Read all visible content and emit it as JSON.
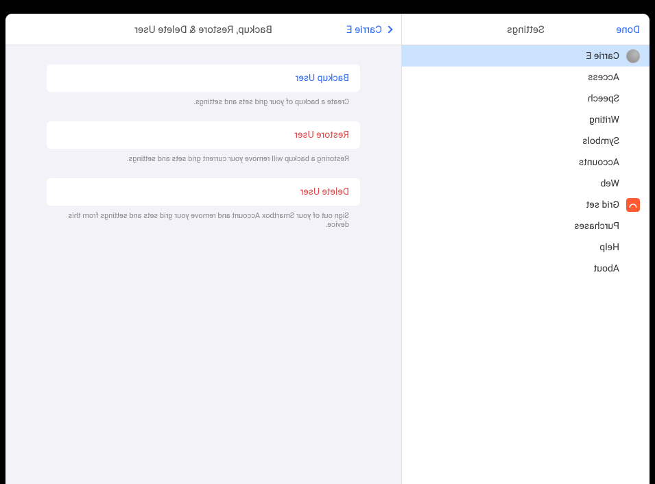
{
  "header": {
    "done": "Done",
    "settings_title": "Settings",
    "back_label": "Carrie E",
    "page_title": "Backup, Restore & Delete User"
  },
  "sidebar": {
    "user": {
      "name": "Carrie E"
    },
    "items": [
      {
        "label": "Access"
      },
      {
        "label": "Speech"
      },
      {
        "label": "Writing"
      },
      {
        "label": "Symbols"
      },
      {
        "label": "Accounts"
      },
      {
        "label": "Web"
      },
      {
        "label": "Grid set",
        "icon": "gridset"
      },
      {
        "label": "Purchases"
      },
      {
        "label": "Help"
      },
      {
        "label": "About"
      }
    ]
  },
  "actions": {
    "backup": {
      "title": "Backup User",
      "desc": "Create a backup of your grid sets and settings."
    },
    "restore": {
      "title": "Restore User",
      "desc": "Restoring a backup will remove your current grid sets and settings."
    },
    "delete": {
      "title": "Delete User",
      "desc": "Sign out of your Smartbox Account and remove your grid sets and settings from this device."
    }
  }
}
